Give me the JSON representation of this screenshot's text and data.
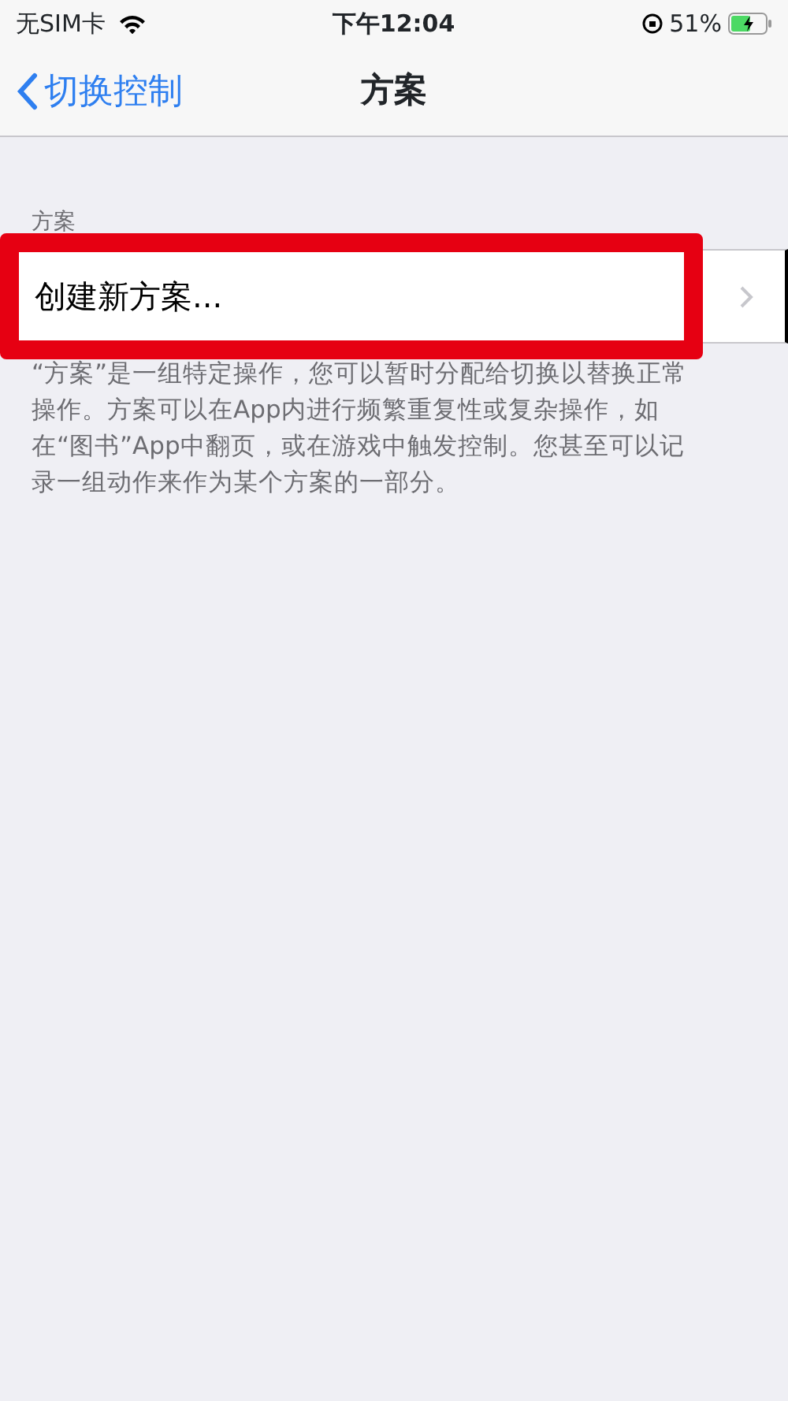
{
  "status_bar": {
    "carrier": "无SIM卡",
    "time": "下午12:04",
    "battery": "51%"
  },
  "nav_bar": {
    "back": "切换控制",
    "title": "方案"
  },
  "section": {
    "header": "方案",
    "rows": [
      {
        "label": "创建新方案...",
        "highlighted": true
      }
    ],
    "footer": "“方案”是一组特定操作，您可以暂时分配给切换以替换正常操作。方案可以在App内进行频繁重复性或复杂操作，如在“图书”App中翻页，或在游戏中触发控制。您甚至可以记录一组动作来作为某个方案的一部分。"
  }
}
